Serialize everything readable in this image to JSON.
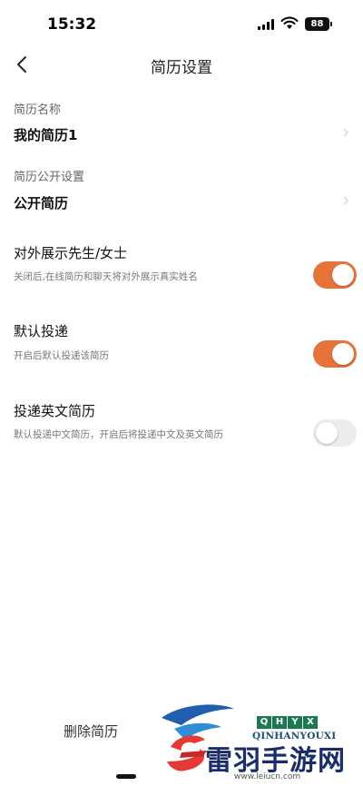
{
  "status_bar": {
    "time": "15:32",
    "battery": "88"
  },
  "nav": {
    "title": "简历设置"
  },
  "resume_name": {
    "label": "简历名称",
    "value": "我的简历1"
  },
  "public_setting": {
    "label": "简历公开设置",
    "value": "公开简历"
  },
  "settings": [
    {
      "title": "对外展示先生/女士",
      "desc": "关闭后,在线简历和聊天将对外展示真实姓名",
      "on": true
    },
    {
      "title": "默认投递",
      "desc": "开启后默认投递该简历",
      "on": true
    },
    {
      "title": "投递英文简历",
      "desc": "默认投递中文简历，开启后将投递中文及英文简历",
      "on": false
    }
  ],
  "bottom": {
    "delete_label": "删除简历"
  },
  "watermark": {
    "brand_letters": [
      "Q",
      "H",
      "Y",
      "X"
    ],
    "brand_sub": "QINHANYOUXI",
    "title": "雷羽手游网",
    "url": "www.leiucn.com"
  },
  "colors": {
    "toggle_on": "#e6733a",
    "toggle_off": "#ececec"
  }
}
